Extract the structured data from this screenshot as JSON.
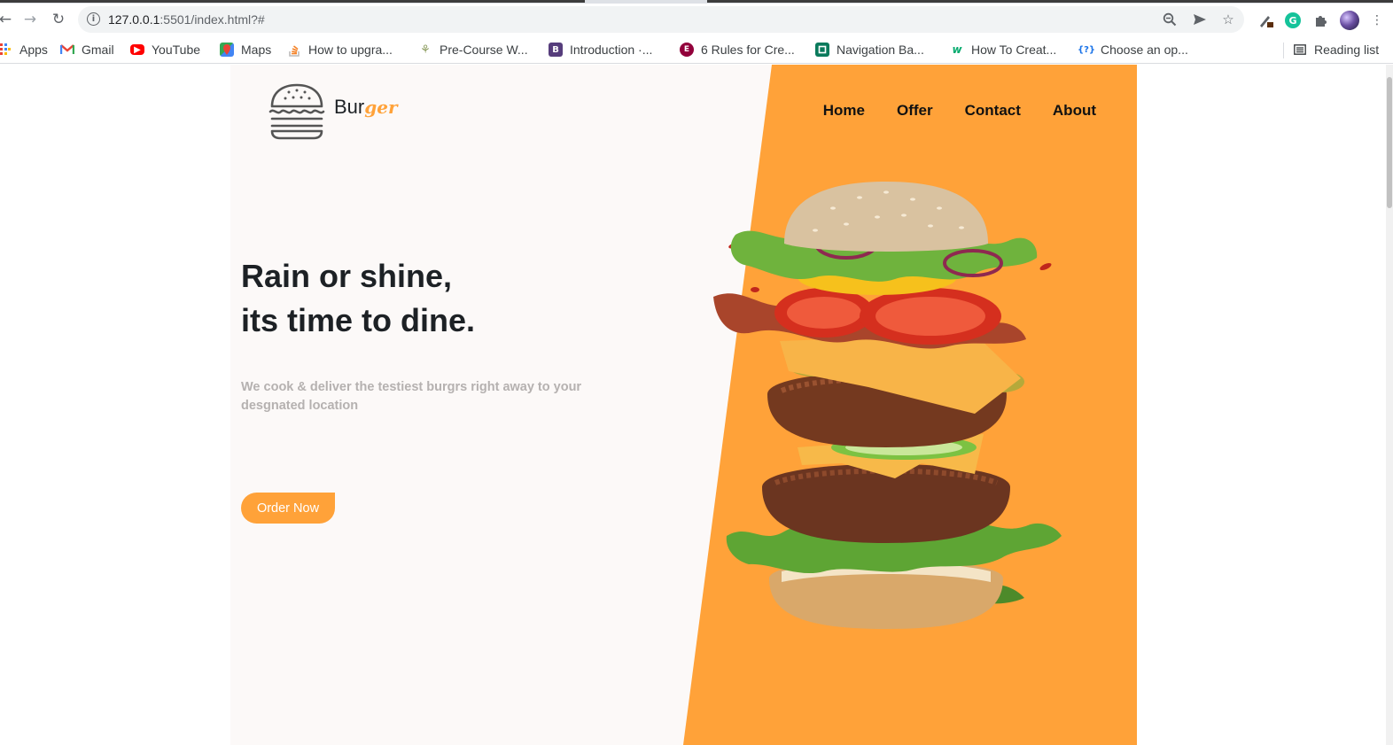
{
  "browser": {
    "url_host": "127.0.0.1",
    "url_rest": ":5501/index.html?#",
    "icons": [
      "back-icon",
      "forward-icon",
      "reload-icon",
      "site-info-icon",
      "zoom-icon",
      "send-icon",
      "bookmark-star-icon",
      "extension-pen-icon",
      "grammarly-icon",
      "puzzle-icon",
      "profile-avatar",
      "menu-kebab-icon"
    ],
    "grammarly_letter": "G"
  },
  "bookmarks": [
    {
      "label": "Apps",
      "icon": "apps-grid-icon",
      "color": "#ea4335"
    },
    {
      "label": "Gmail",
      "icon": "gmail-icon",
      "color": "#ea4335"
    },
    {
      "label": "YouTube",
      "icon": "youtube-icon",
      "color": "#ff0000"
    },
    {
      "label": "Maps",
      "icon": "maps-icon",
      "color": "#34a853"
    },
    {
      "label": "How to upgra...",
      "icon": "stackoverflow-icon",
      "color": "#f48024"
    },
    {
      "label": "Pre-Course W...",
      "icon": "tree-icon",
      "color": "#8a9a5b"
    },
    {
      "label": "Introduction ·...",
      "icon": "bootstrap-icon",
      "color": "#563d7c"
    },
    {
      "label": "6 Rules for Cre...",
      "icon": "elementor-icon",
      "color": "#92003b"
    },
    {
      "label": "Navigation Ba...",
      "icon": "codepen-icon",
      "color": "#0a7a5c"
    },
    {
      "label": "How To Creat...",
      "icon": "w3schools-icon",
      "color": "#04aa6d"
    },
    {
      "label": "Choose an op...",
      "icon": "code-braces-icon",
      "color": "#1a73e8"
    }
  ],
  "reading_list": "Reading list",
  "site": {
    "brand_plain": "Bur",
    "brand_accent": "ger",
    "nav": [
      "Home",
      "Offer",
      "Contact",
      "About"
    ],
    "headline_line1": "Rain or shine,",
    "headline_line2": "its time to dine.",
    "description": "We cook & deliver the testiest burgrs right away to your desgnated location",
    "cta_label": "Order Now",
    "hero_image": "exploded-burger-photo"
  },
  "colors": {
    "accent": "#ffa239",
    "page_bg": "#fcf9f8",
    "headline": "#1d2125",
    "muted_text": "#b5b1b0"
  }
}
